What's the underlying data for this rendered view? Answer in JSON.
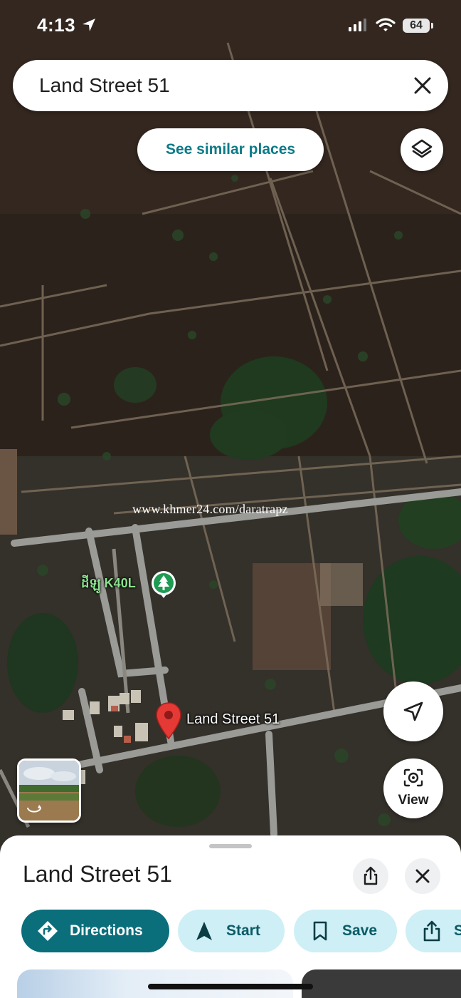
{
  "status_bar": {
    "time": "4:13",
    "battery": "64"
  },
  "search": {
    "query": "Land Street 51"
  },
  "map": {
    "similar_places_label": "See similar places",
    "watermark": "www.khmer24.com/daratrapz",
    "poi_label": "ដីឡូ K40L",
    "pin_label": "Land Street 51",
    "view_label": "View"
  },
  "sheet": {
    "title": "Land Street 51",
    "actions": [
      {
        "label": "Directions"
      },
      {
        "label": "Start"
      },
      {
        "label": "Save"
      },
      {
        "label": "S"
      }
    ]
  },
  "colors": {
    "accent": "#0b6e7b",
    "chip_bg": "#cdeff5",
    "pin": "#e53935",
    "poi": "#1e9a53"
  }
}
